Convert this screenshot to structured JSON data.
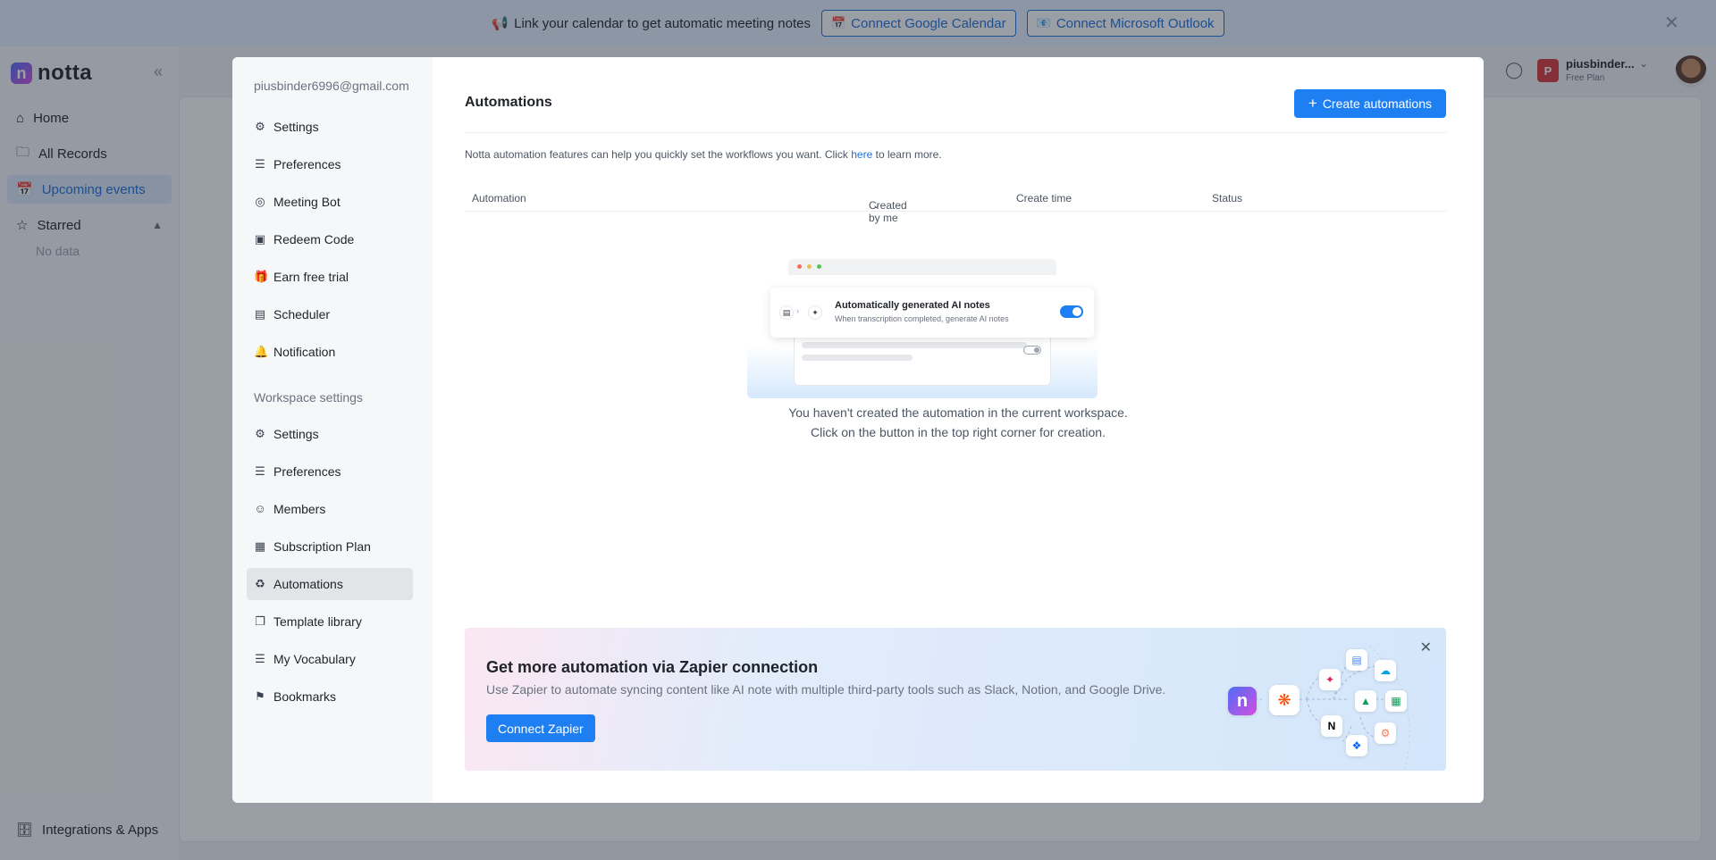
{
  "banner": {
    "message": "Link your calendar to get automatic meeting notes",
    "google_btn": "Connect Google Calendar",
    "outlook_btn": "Connect Microsoft Outlook"
  },
  "app": {
    "logo_text": "notta",
    "nav": [
      {
        "label": "Home",
        "icon": "home-icon"
      },
      {
        "label": "All Records",
        "icon": "folder-icon"
      },
      {
        "label": "Upcoming events",
        "icon": "calendar-icon",
        "active": true
      }
    ],
    "starred_label": "Starred",
    "starred_empty": "No data",
    "integrations_label": "Integrations & Apps",
    "user": {
      "initial": "P",
      "name": "piusbinder...",
      "plan": "Free Plan"
    }
  },
  "modal": {
    "email": "piusbinder6996@gmail.com",
    "personal_items": [
      {
        "label": "Settings",
        "icon": "gear-icon"
      },
      {
        "label": "Preferences",
        "icon": "sliders-icon"
      },
      {
        "label": "Meeting Bot",
        "icon": "bot-icon"
      },
      {
        "label": "Redeem Code",
        "icon": "ticket-icon"
      },
      {
        "label": "Earn free trial",
        "icon": "gift-icon"
      },
      {
        "label": "Scheduler",
        "icon": "scheduler-icon"
      },
      {
        "label": "Notification",
        "icon": "bell-icon"
      }
    ],
    "workspace_section": "Workspace settings",
    "workspace_items": [
      {
        "label": "Settings",
        "icon": "gear-icon"
      },
      {
        "label": "Preferences",
        "icon": "sliders-icon"
      },
      {
        "label": "Members",
        "icon": "user-icon"
      },
      {
        "label": "Subscription Plan",
        "icon": "map-icon"
      },
      {
        "label": "Automations",
        "icon": "automation-icon",
        "active": true
      },
      {
        "label": "Template library",
        "icon": "template-icon"
      },
      {
        "label": "My Vocabulary",
        "icon": "list-icon"
      },
      {
        "label": "Bookmarks",
        "icon": "bookmark-icon"
      }
    ],
    "main": {
      "title": "Automations",
      "create_btn": "Create automations",
      "desc_before": "Notta automation features can help you quickly set the workflows you want. Click",
      "desc_link": "here",
      "desc_after": "to learn more.",
      "columns": {
        "automation": "Automation",
        "created_by": "Created by me",
        "create_time": "Create time",
        "status": "Status"
      },
      "illus": {
        "card_title": "Automatically generated AI notes",
        "card_sub": "When transcription completed, generate AI notes"
      },
      "empty_line1": "You haven't created the automation in the current workspace.",
      "empty_line2": "Click on the button in the top right corner for creation.",
      "zapier": {
        "title": "Get more automation via Zapier connection",
        "desc": "Use Zapier to automate syncing content like AI note with multiple third-party tools such as Slack, Notion, and Google Drive.",
        "button": "Connect Zapier"
      }
    }
  },
  "colors": {
    "accent": "#1e7ff2",
    "link": "#1e6fd9",
    "active_nav": "#dce9fb"
  }
}
